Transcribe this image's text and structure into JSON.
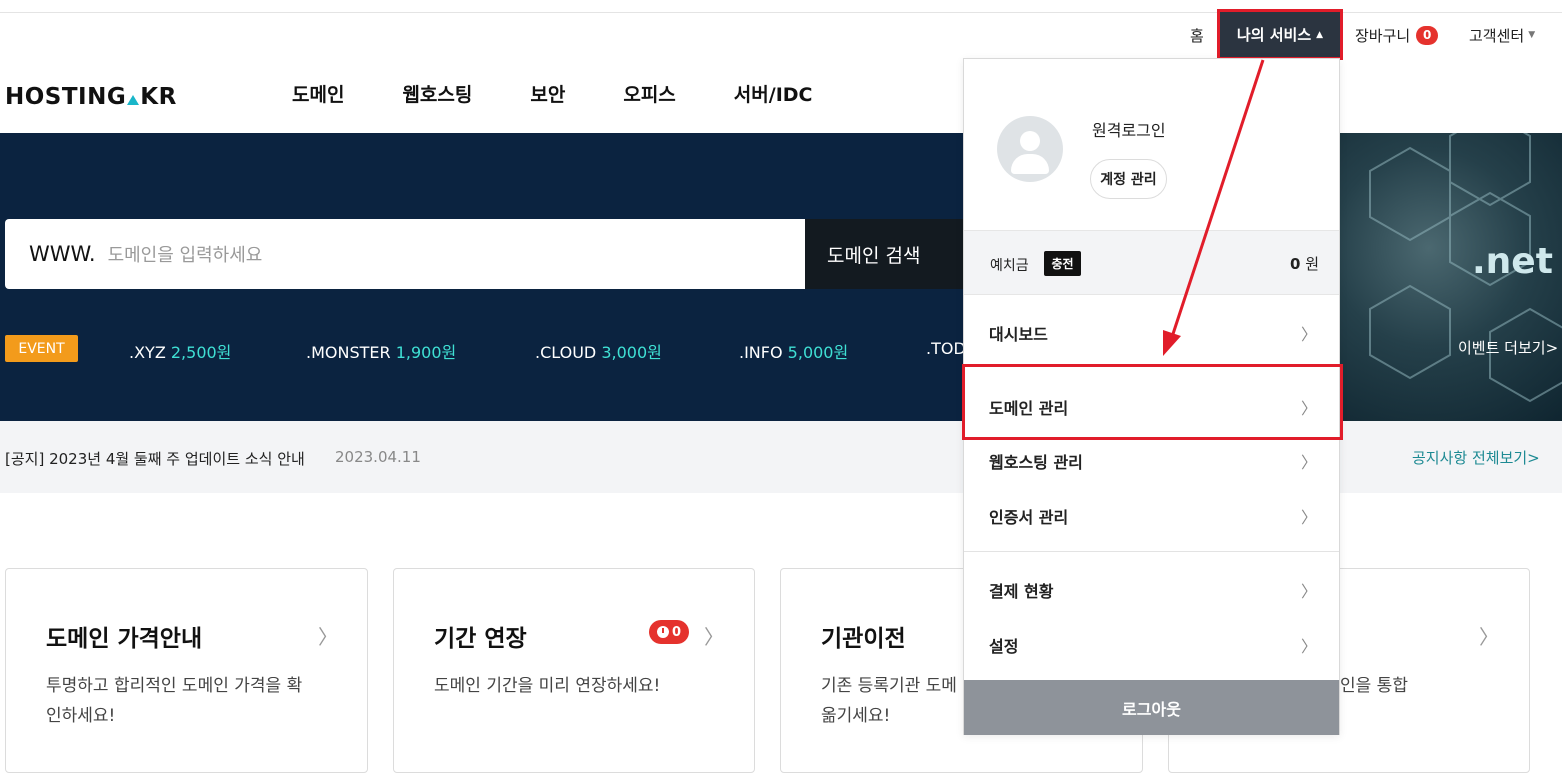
{
  "util": {
    "home": "홈",
    "my_service": "나의 서비스",
    "cart": "장바구니",
    "cart_count": "0",
    "customer_center": "고객센터"
  },
  "header": {
    "logo_left": "HOSTING",
    "logo_right": "KR",
    "nav": [
      "도메인",
      "웹호스팅",
      "보안",
      "오피스",
      "서버/IDC"
    ]
  },
  "search": {
    "prefix": "WWW.",
    "placeholder": "도메인을 입력하세요",
    "button": "도메인 검색"
  },
  "hero": {
    "event_badge": "EVENT",
    "promos": [
      {
        "tld": ".XYZ",
        "price": "2,500원"
      },
      {
        "tld": ".MONSTER",
        "price": "1,900원"
      },
      {
        "tld": ".CLOUD",
        "price": "3,000원"
      },
      {
        "tld": ".INFO",
        "price": "5,000원"
      },
      {
        "tld": ".TOD",
        "price": ""
      }
    ],
    "banner_text": ".net",
    "event_more": "이벤트 더보기>"
  },
  "notice": {
    "text": "[공지] 2023년 4월 둘째 주 업데이트 소식 안내",
    "date": "2023.04.11",
    "view_all": "공지사항 전체보기>"
  },
  "cards": [
    {
      "title": "도메인 가격안내",
      "desc": "투명하고 합리적인 도메인 가격을 확인하세요!"
    },
    {
      "title": "기간 연장",
      "desc": "도메인 기간을 미리 연장하세요!",
      "badge": "0"
    },
    {
      "title": "기관이전",
      "desc": "기존 등록기관 도메",
      "desc2": "옮기세요!"
    },
    {
      "title": "",
      "desc": "인을 통합"
    }
  ],
  "dropdown": {
    "remote_login": "원격로그인",
    "account_manage": "계정 관리",
    "deposit_label": "예치금",
    "charge": "충전",
    "deposit_amount": "0",
    "deposit_unit": "원",
    "menu": [
      "대시보드",
      "도메인 관리",
      "웹호스팅 관리",
      "인증서 관리",
      "결제 현황",
      "설정"
    ],
    "logout": "로그아웃"
  },
  "colors": {
    "hero_bg": "#0b2340",
    "accent_price": "#3fe0d4",
    "event_orange": "#f39b1b",
    "highlight_red": "#e11d2a",
    "dark_button": "#2b3440",
    "link_teal": "#1d8a93"
  }
}
